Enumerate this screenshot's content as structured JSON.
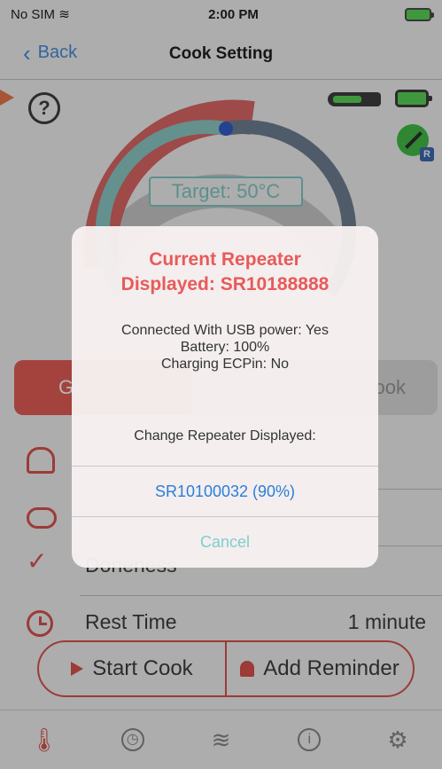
{
  "status_bar": {
    "carrier": "No SIM",
    "wifi_icon": "wifi-icon",
    "time": "2:00 PM",
    "battery_icon": "charging-battery-icon"
  },
  "nav": {
    "back_label": "Back",
    "title": "Cook Setting"
  },
  "gauge": {
    "target_label": "Target: 50°C",
    "progress_color": "#d9534f",
    "inner_color": "#6fbfbc"
  },
  "segmented": {
    "left_label": "G",
    "right_label": "ook"
  },
  "rows": [
    {
      "icon": "chef-hat-icon",
      "label": "",
      "value": ""
    },
    {
      "icon": "steak-icon",
      "label": "",
      "value": ""
    },
    {
      "icon": "check-icon",
      "label": "Doneness",
      "value": ""
    },
    {
      "icon": "clock-icon",
      "label": "Rest Time",
      "value": "1 minute"
    }
  ],
  "buttons": {
    "start": "Start Cook",
    "reminder": "Add Reminder"
  },
  "tabs": [
    "thermometer-icon",
    "clock-icon",
    "wifi-icon",
    "info-icon",
    "gear-icon"
  ],
  "alert": {
    "title": "Current Repeater\nDisplayed: SR10188888",
    "line1": "Connected With USB power: Yes",
    "line2": "Battery: 100%",
    "line3": "Charging ECPin: No",
    "change_label": "Change Repeater Displayed:",
    "option": "SR10100032 (90%)",
    "cancel": "Cancel"
  },
  "colors": {
    "accent_red": "#d73a34",
    "link_blue": "#2a7fd9",
    "teal": "#6fc4c0"
  }
}
